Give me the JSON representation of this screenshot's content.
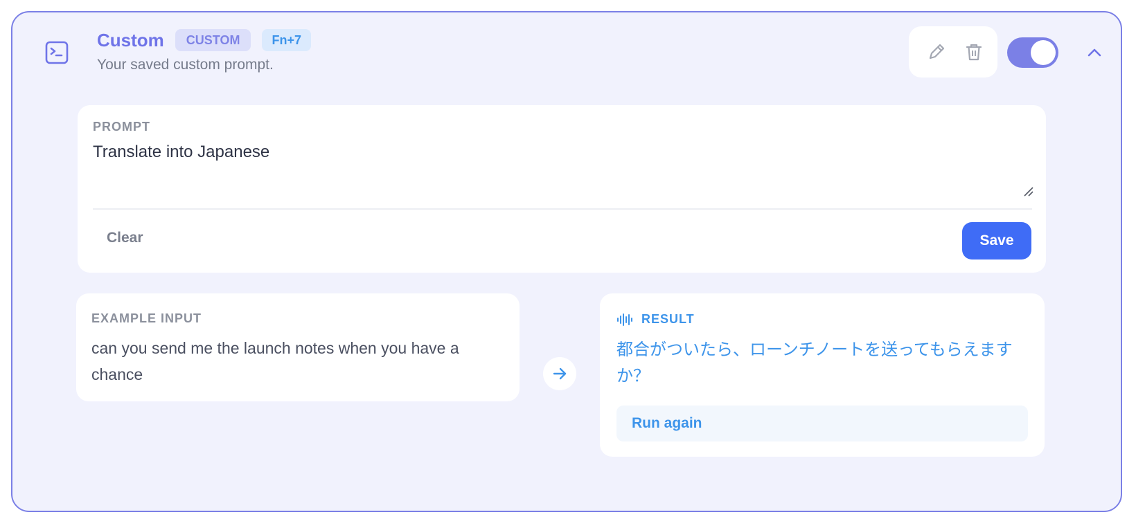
{
  "header": {
    "title": "Custom",
    "badge_type": "CUSTOM",
    "shortcut": "Fn+7",
    "subtitle": "Your saved custom prompt.",
    "icon": "terminal-icon",
    "enabled": true
  },
  "actions": {
    "edit_icon": "pencil-icon",
    "delete_icon": "trash-icon",
    "collapse_icon": "chevron-up-icon"
  },
  "prompt": {
    "label": "PROMPT",
    "value": "Translate into Japanese",
    "clear_label": "Clear",
    "save_label": "Save"
  },
  "example": {
    "label": "EXAMPLE INPUT",
    "text": "can you send me the launch notes when you have a chance"
  },
  "result": {
    "label": "RESULT",
    "icon": "waveform-icon",
    "text": "都合がついたら、ローンチノートを送ってもらえますか？",
    "run_again_label": "Run again"
  },
  "colors": {
    "accent": "#7b80e6",
    "primary_button": "#3f6cf6",
    "result_blue": "#3d94ea",
    "card_background": "#f1f2fd"
  }
}
